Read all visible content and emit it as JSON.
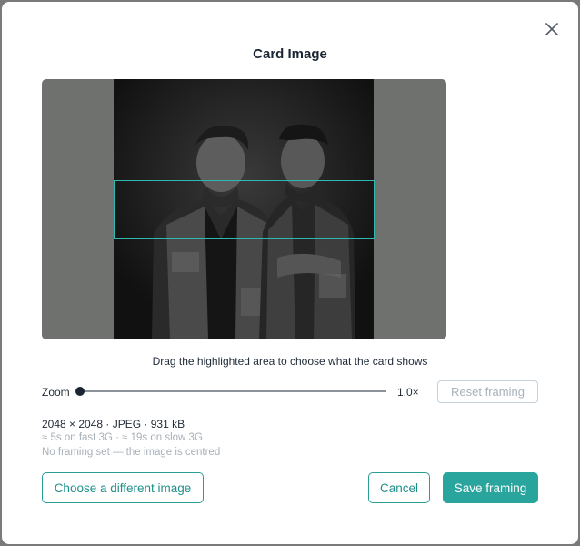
{
  "modal": {
    "title": "Card Image",
    "close_icon": "close-icon"
  },
  "cropper": {
    "hint": "Drag the highlighted area to choose what the card shows",
    "zoom_label": "Zoom",
    "zoom_value": "1.0×",
    "zoom_level": 0,
    "reset_label": "Reset framing",
    "accent_color": "#2fb7b0"
  },
  "image_info": {
    "dimensions": "2048 × 2048 · JPEG · 931 kB",
    "load_estimate": "≈ 5s on fast 3G · ≈ 19s on slow 3G",
    "framing_status": "No framing set — the image is centred"
  },
  "actions": {
    "choose_label": "Choose a different image",
    "cancel_label": "Cancel",
    "save_label": "Save framing",
    "primary_color": "#2aa59d"
  }
}
